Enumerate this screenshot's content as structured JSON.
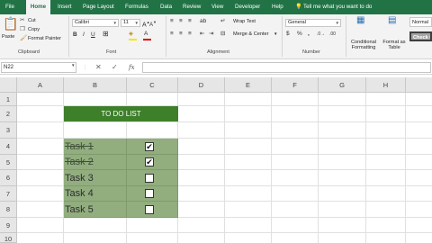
{
  "ribbon_tabs": [
    "File",
    "Home",
    "Insert",
    "Page Layout",
    "Formulas",
    "Data",
    "Review",
    "View",
    "Developer",
    "Help"
  ],
  "active_tab": "Home",
  "tell_me": "Tell me what you want to do",
  "clipboard": {
    "paste": "Paste",
    "cut": "Cut",
    "copy": "Copy",
    "format_painter": "Format Painter",
    "label": "Clipboard"
  },
  "font": {
    "name": "Calibri",
    "size": "11",
    "label": "Font"
  },
  "alignment": {
    "wrap_text": "Wrap Text",
    "merge_center": "Merge & Center",
    "label": "Alignment"
  },
  "number": {
    "format": "General",
    "currency_symbol": "$",
    "percent_symbol": "%",
    "label": "Number"
  },
  "styles": {
    "conditional_formatting": "Conditional Formatting",
    "format_as_table": "Format as Table",
    "normal": "Normal",
    "check_cell": "Check C"
  },
  "formula_bar": {
    "name_box": "N22",
    "fx": "fx",
    "formula": ""
  },
  "columns": [
    "A",
    "B",
    "C",
    "D",
    "E",
    "F",
    "G",
    "H"
  ],
  "rows": [
    "1",
    "2",
    "3",
    "4",
    "5",
    "6",
    "7",
    "8",
    "9",
    "10"
  ],
  "todo": {
    "title": "TO DO LIST",
    "tasks": [
      {
        "label": "Task 1",
        "done": true,
        "check": "✔"
      },
      {
        "label": "Task 2",
        "done": true,
        "check": "✔"
      },
      {
        "label": "Task 3",
        "done": false,
        "check": ""
      },
      {
        "label": "Task 4",
        "done": false,
        "check": ""
      },
      {
        "label": "Task 5",
        "done": false,
        "check": ""
      }
    ]
  },
  "colors": {
    "excel_green": "#217346",
    "header_green": "#3e7f2a",
    "task_fill": "#92ae7f"
  }
}
